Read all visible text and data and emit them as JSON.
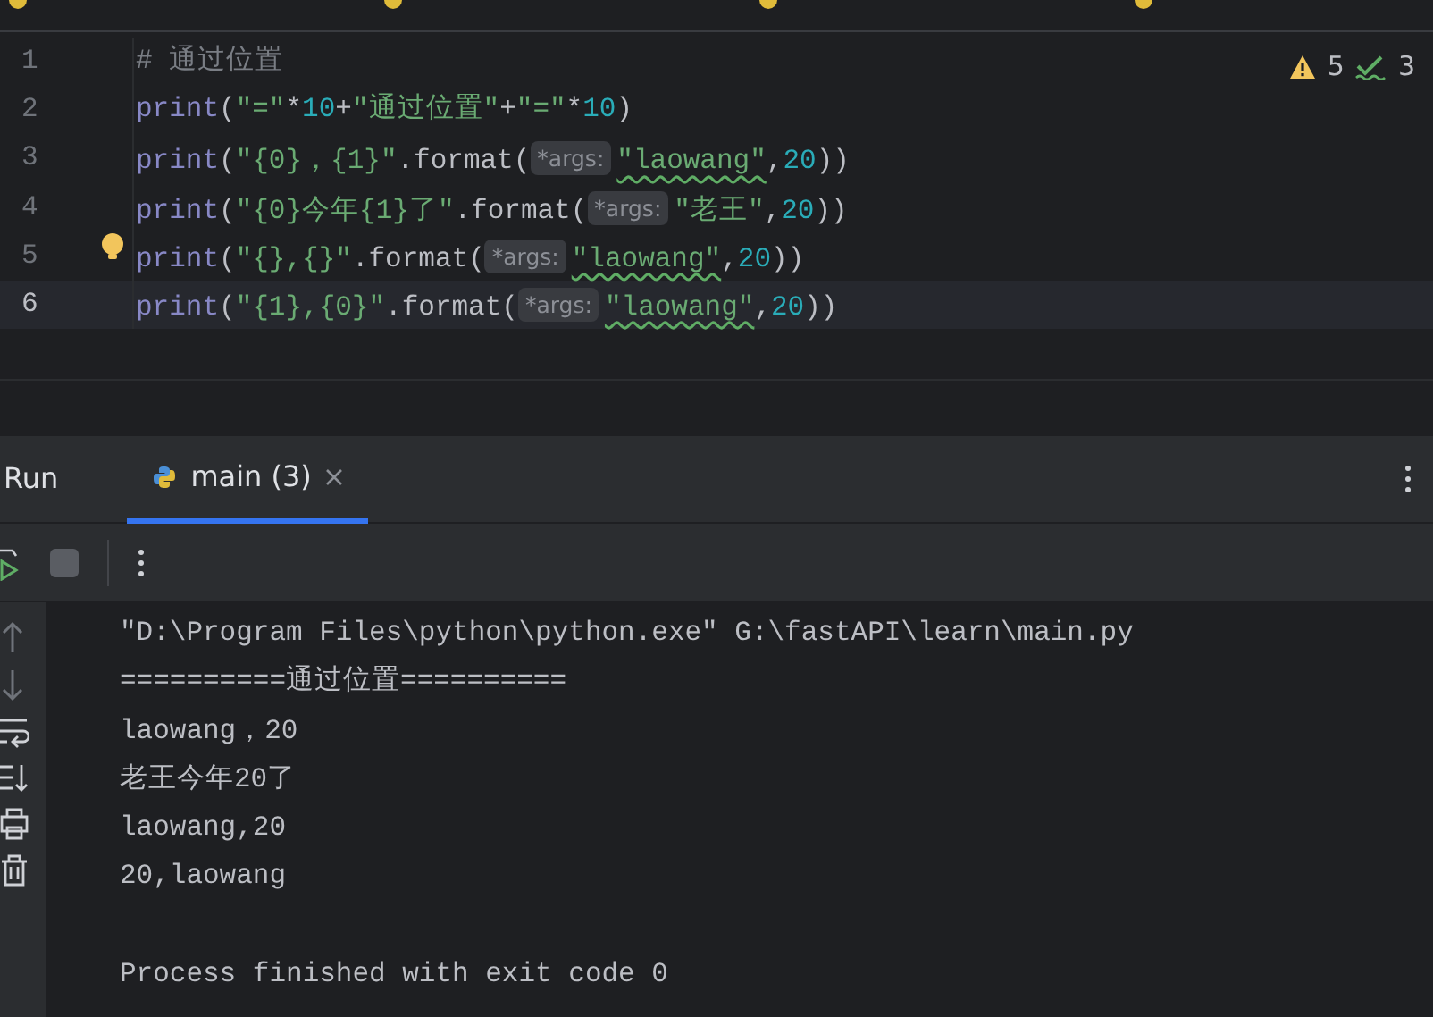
{
  "editor": {
    "inspections": {
      "warnings": "5",
      "typos": "3"
    },
    "lines": [
      {
        "number": "1",
        "current": false,
        "bulb": false,
        "tokens": [
          {
            "text": "# 通过位置",
            "kind": "comment"
          }
        ]
      },
      {
        "number": "2",
        "current": false,
        "bulb": false,
        "tokens": [
          {
            "text": "print",
            "kind": "builtin"
          },
          {
            "text": "(",
            "kind": "plain"
          },
          {
            "text": "\"=\"",
            "kind": "string"
          },
          {
            "text": "*",
            "kind": "plain"
          },
          {
            "text": "10",
            "kind": "number"
          },
          {
            "text": "+",
            "kind": "plain"
          },
          {
            "text": "\"通过位置\"",
            "kind": "string"
          },
          {
            "text": "+",
            "kind": "plain"
          },
          {
            "text": "\"=\"",
            "kind": "string"
          },
          {
            "text": "*",
            "kind": "plain"
          },
          {
            "text": "10",
            "kind": "number"
          },
          {
            "text": ")",
            "kind": "plain"
          }
        ]
      },
      {
        "number": "3",
        "current": false,
        "bulb": false,
        "tokens": [
          {
            "text": "print",
            "kind": "builtin"
          },
          {
            "text": "(",
            "kind": "plain"
          },
          {
            "text": "\"{0}，{1}\"",
            "kind": "string"
          },
          {
            "text": ".format(",
            "kind": "plain"
          },
          {
            "text": "*args:",
            "kind": "hint"
          },
          {
            "text": "\"laowang\"",
            "kind": "typo"
          },
          {
            "text": ",",
            "kind": "plain"
          },
          {
            "text": "20",
            "kind": "number"
          },
          {
            "text": "))",
            "kind": "plain"
          }
        ]
      },
      {
        "number": "4",
        "current": false,
        "bulb": false,
        "tokens": [
          {
            "text": "print",
            "kind": "builtin"
          },
          {
            "text": "(",
            "kind": "plain"
          },
          {
            "text": "\"{0}今年{1}了\"",
            "kind": "string"
          },
          {
            "text": ".format(",
            "kind": "plain"
          },
          {
            "text": "*args:",
            "kind": "hint"
          },
          {
            "text": "\"老王\"",
            "kind": "string"
          },
          {
            "text": ",",
            "kind": "plain"
          },
          {
            "text": "20",
            "kind": "number"
          },
          {
            "text": "))",
            "kind": "plain"
          }
        ]
      },
      {
        "number": "5",
        "current": false,
        "bulb": true,
        "tokens": [
          {
            "text": "print",
            "kind": "builtin"
          },
          {
            "text": "(",
            "kind": "plain"
          },
          {
            "text": "\"{},{}\"",
            "kind": "string"
          },
          {
            "text": ".format(",
            "kind": "plain"
          },
          {
            "text": "*args:",
            "kind": "hint"
          },
          {
            "text": "\"laowang\"",
            "kind": "typo"
          },
          {
            "text": ",",
            "kind": "plain"
          },
          {
            "text": "20",
            "kind": "number"
          },
          {
            "text": "))",
            "kind": "plain"
          }
        ]
      },
      {
        "number": "6",
        "current": true,
        "bulb": false,
        "tokens": [
          {
            "text": "print",
            "kind": "builtin"
          },
          {
            "text": "(",
            "kind": "plain"
          },
          {
            "text": "\"{1},{0}\"",
            "kind": "string"
          },
          {
            "text": ".format(",
            "kind": "plain"
          },
          {
            "text": "*args:",
            "kind": "hint"
          },
          {
            "text": "\"laowang\"",
            "kind": "typo"
          },
          {
            "text": ",",
            "kind": "plain"
          },
          {
            "text": "20",
            "kind": "number"
          },
          {
            "text": "))",
            "kind": "plain"
          }
        ]
      }
    ]
  },
  "run_panel": {
    "title": "Run",
    "tabs": [
      {
        "label": "main (3)",
        "selected": true
      }
    ],
    "output": [
      {
        "text": "\"D:\\Program Files\\python\\python.exe\" G:\\fastAPI\\learn\\main.py",
        "kind": "command"
      },
      {
        "text": "==========通过位置==========",
        "kind": "stdout"
      },
      {
        "text": "laowang，20",
        "kind": "stdout"
      },
      {
        "text": "老王今年20了",
        "kind": "stdout"
      },
      {
        "text": "laowang,20",
        "kind": "stdout"
      },
      {
        "text": "20,laowang",
        "kind": "stdout"
      },
      {
        "text": "Process finished with exit code 0",
        "kind": "exit"
      }
    ]
  }
}
